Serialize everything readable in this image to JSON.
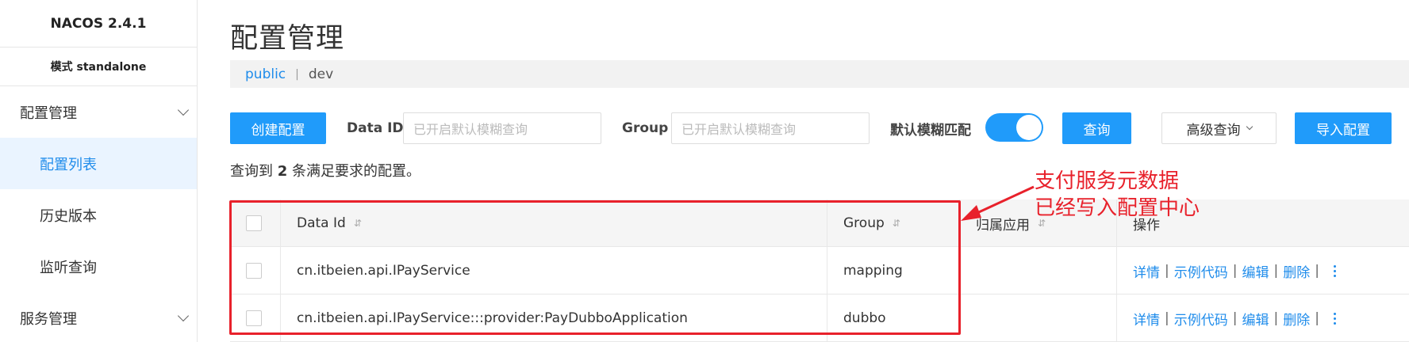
{
  "sidebar": {
    "brand": "NACOS 2.4.1",
    "mode": "模式 standalone",
    "groups": [
      {
        "label": "配置管理"
      },
      {
        "label": "服务管理"
      }
    ],
    "items": [
      {
        "label": "配置列表"
      },
      {
        "label": "历史版本"
      },
      {
        "label": "监听查询"
      }
    ]
  },
  "page": {
    "title": "配置管理",
    "namespaces": [
      "public",
      "dev"
    ],
    "ns_separator": "|"
  },
  "toolbar": {
    "create_label": "创建配置",
    "dataid_label": "Data ID",
    "dataid_placeholder": "已开启默认模糊查询",
    "group_label": "Group",
    "group_placeholder": "已开启默认模糊查询",
    "fuzzy_label": "默认模糊匹配",
    "fuzzy_on": true,
    "query_label": "查询",
    "advanced_label": "高级查询",
    "import_label": "导入配置"
  },
  "result": {
    "prefix": "查询到",
    "count": "2",
    "suffix": "条满足要求的配置。"
  },
  "table": {
    "columns": [
      "Data Id",
      "Group",
      "归属应用",
      "操作"
    ],
    "rows": [
      {
        "data_id": "cn.itbeien.api.IPayService",
        "group": "mapping",
        "app": ""
      },
      {
        "data_id": "cn.itbeien.api.IPayService:::provider:PayDubboApplication",
        "group": "dubbo",
        "app": ""
      }
    ],
    "actions": [
      "详情",
      "示例代码",
      "编辑",
      "删除"
    ],
    "action_sep": "|"
  },
  "annotation": {
    "line1": "支付服务元数据",
    "line2": "已经写入配置中心",
    "color": "#e8212b"
  },
  "colors": {
    "primary": "#209bfa",
    "link": "#1f8ceb"
  }
}
